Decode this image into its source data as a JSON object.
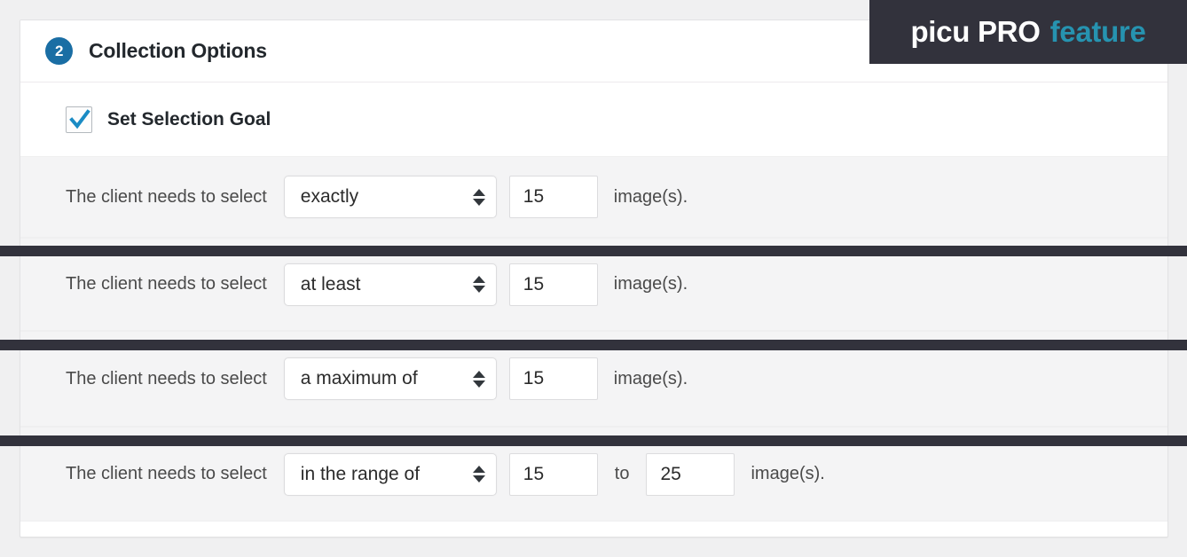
{
  "pro_badge": {
    "main_text": "picu PRO",
    "accent_text": "feature",
    "white_color": "#ffffff",
    "accent_color": "#2693b0",
    "background_color": "#32323c"
  },
  "card": {
    "step_number": "2",
    "title": "Collection Options",
    "badge_color": "#1a6ea4"
  },
  "checkbox_row": {
    "label": "Set Selection Goal",
    "checked": true,
    "check_color": "#1a8bc4"
  },
  "rows": [
    {
      "lead_text": "The client needs to select",
      "select_value": "exactly",
      "value_1": "15",
      "mid_text": "",
      "value_2": "",
      "tail_text": "image(s)."
    },
    {
      "lead_text": "The client needs to select",
      "select_value": "at least",
      "value_1": "15",
      "mid_text": "",
      "value_2": "",
      "tail_text": "image(s)."
    },
    {
      "lead_text": "The client needs to select",
      "select_value": "a maximum of",
      "value_1": "15",
      "mid_text": "",
      "value_2": "",
      "tail_text": "image(s)."
    },
    {
      "lead_text": "The client needs to select",
      "select_value": "in the range of",
      "value_1": "15",
      "mid_text": "to",
      "value_2": "25",
      "tail_text": "image(s)."
    }
  ],
  "separator_color": "#32323c"
}
